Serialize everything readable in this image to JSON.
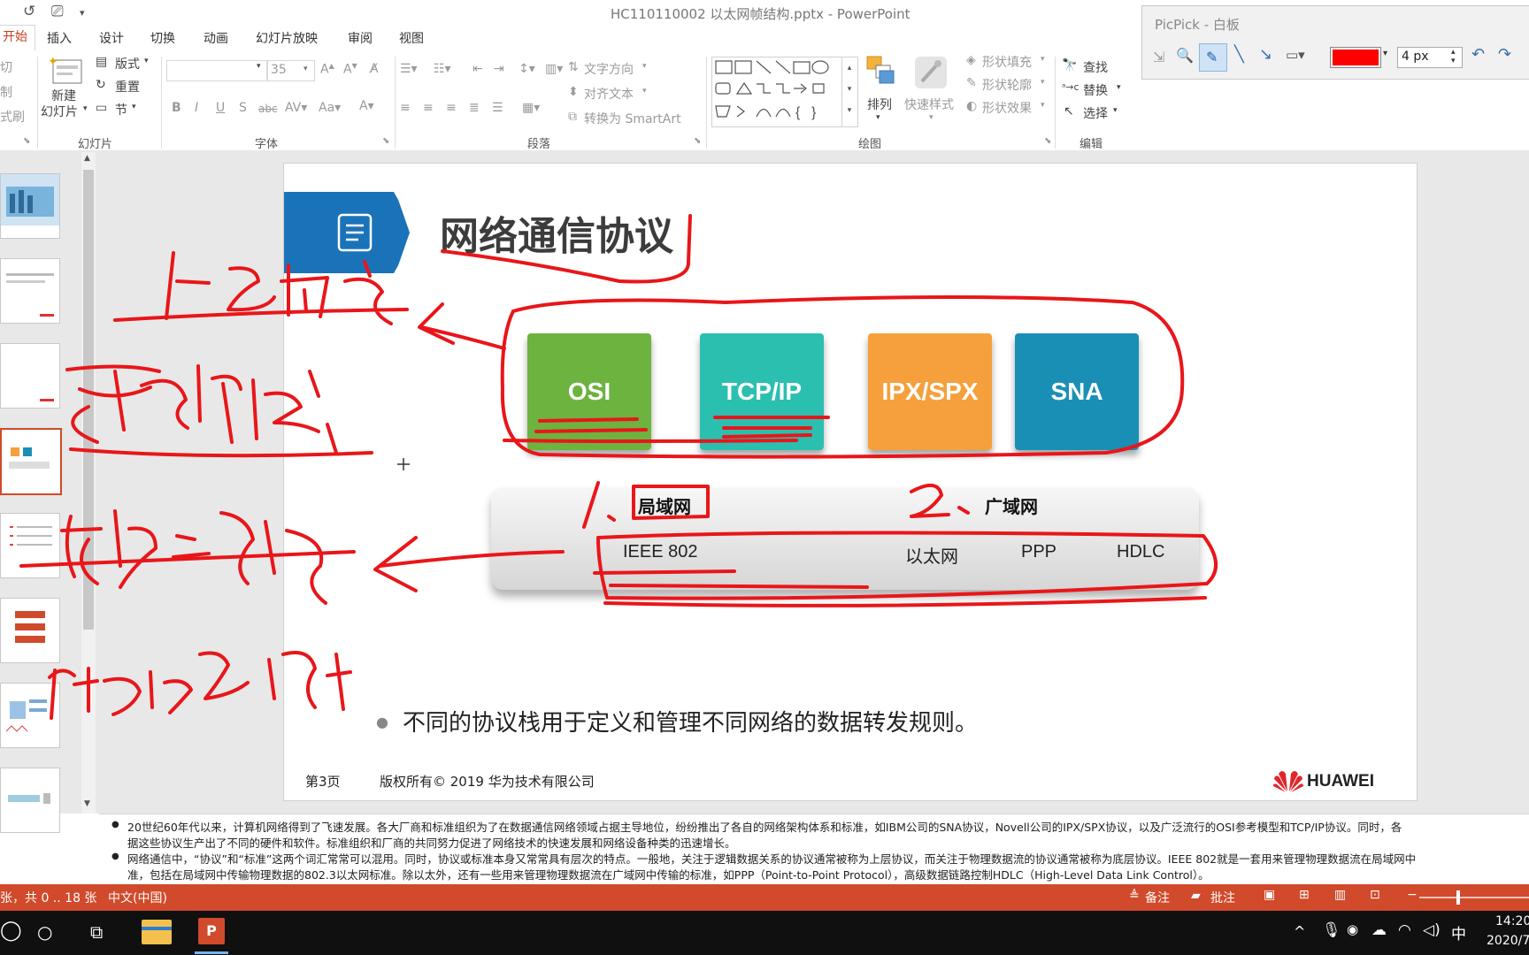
{
  "window": {
    "title": "HC110110002 以太网帧结构.pptx - PowerPoint"
  },
  "tabs": [
    {
      "label": "开始",
      "active": true
    },
    {
      "label": "插入"
    },
    {
      "label": "设计"
    },
    {
      "label": "切换"
    },
    {
      "label": "动画"
    },
    {
      "label": "幻灯片放映"
    },
    {
      "label": "审阅"
    },
    {
      "label": "视图"
    }
  ],
  "ribbon": {
    "clipboard": {
      "cut": "切",
      "copy": "制",
      "format_painter": "式刷"
    },
    "slides": {
      "new_slide_line1": "新建",
      "new_slide_line2": "幻灯片",
      "layout": "版式",
      "reset": "重置",
      "section": "节",
      "group": "幻灯片"
    },
    "font": {
      "size": "35",
      "group": "字体"
    },
    "paragraph": {
      "text_direction": "文字方向",
      "align_text": "对齐文本",
      "convert_smartart": "转换为 SmartArt",
      "group": "段落"
    },
    "drawing": {
      "arrange": "排列",
      "quick_styles": "快速样式",
      "shape_fill": "形状填充",
      "shape_outline": "形状轮廓",
      "shape_effects": "形状效果",
      "group": "绘图"
    },
    "editing": {
      "find": "查找",
      "replace": "替换",
      "select": "选择",
      "group": "编辑"
    }
  },
  "picpick": {
    "title": "PicPick - 白板",
    "color": "#ff0000",
    "pen_width": "4 px"
  },
  "slide": {
    "title": "网络通信协议",
    "protocols": [
      {
        "label": "OSI",
        "color": "#6db33f"
      },
      {
        "label": "TCP/IP",
        "color": "#2bbfb0"
      },
      {
        "label": "IPX/SPX",
        "color": "#f5a03c"
      },
      {
        "label": "SNA",
        "color": "#1a8fb5"
      }
    ],
    "lan_label": "局域网",
    "wan_label": "广域网",
    "standards": [
      "IEEE 802",
      "以太网",
      "PPP",
      "HDLC"
    ],
    "bullet": "不同的协议栈用于定义和管理不同网络的数据转发规则。",
    "page": "第3页",
    "copyright": "版权所有© 2019 华为技术有限公司",
    "brand": "HUAWEI",
    "accent": "#1a73b8"
  },
  "annotations": {
    "pen_color": "#e8161a",
    "number_1": "1、",
    "number_2": "2、"
  },
  "notes": {
    "line1": "20世纪60年代以来，计算机网络得到了飞速发展。各大厂商和标准组织为了在数据通信网络领域占据主导地位，纷纷推出了各自的网络架构体系和标准，如IBM公司的SNA协议，Novell公司的IPX/SPX协议，以及广泛流行的OSI参考模型和TCP/IP协议。同时，各",
    "line2": "据这些协议生产出了不同的硬件和软件。标准组织和厂商的共同努力促进了网络技术的快速发展和网络设备种类的迅速增长。",
    "line3": "网络通信中，“协议”和“标准”这两个词汇常常可以混用。同时，协议或标准本身又常常具有层次的特点。一般地，关注于逻辑数据关系的协议通常被称为上层协议，而关注于物理数据流的协议通常被称为底层协议。IEEE 802就是一套用来管理物理数据流在局域网中",
    "line4": "准，包括在局域网中传输物理数据的802.3以太网标准。除以太外，还有一些用来管理物理数据流在广域网中传输的标准，如PPP（Point-to-Point Protocol），高级数据链路控制HDLC（High-Level Data Link Control）。"
  },
  "statusbar": {
    "slide_info": "张，共 0 .. 18 张",
    "language": "中文(中国)",
    "notes_btn": "备注",
    "comments_btn": "批注"
  },
  "taskbar": {
    "ime": "中",
    "time": "14:20",
    "date": "2020/7"
  }
}
